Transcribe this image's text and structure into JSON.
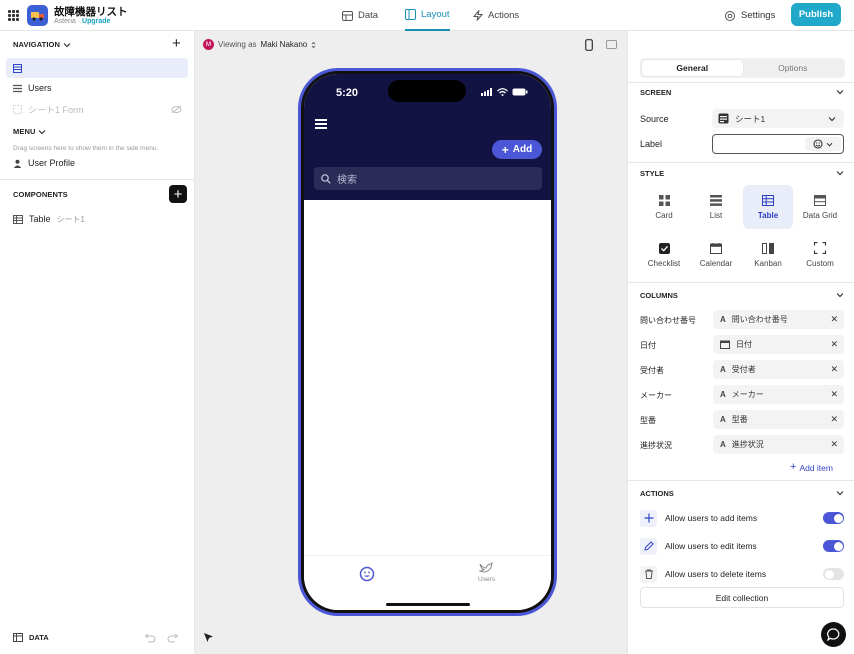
{
  "app": {
    "title": "故障機器リスト",
    "org": "Asteria",
    "separator": " · ",
    "upgrade": "Upgrade"
  },
  "topnav": {
    "tabs": [
      "Data",
      "Layout",
      "Actions"
    ],
    "active_tab": "Layout",
    "settings": "Settings",
    "publish": "Publish"
  },
  "navigation": {
    "header": "NAVIGATION",
    "items": [
      {
        "label": "",
        "selected": true
      },
      {
        "label": "Users"
      },
      {
        "label": "シート1 Form",
        "hidden": true
      }
    ]
  },
  "menu": {
    "header": "MENU",
    "hint": "Drag screens here to show them in the side menu.",
    "items": [
      {
        "label": "User Profile"
      }
    ]
  },
  "components": {
    "header": "COMPONENTS",
    "items": [
      {
        "label": "Table",
        "source": "シート1"
      }
    ]
  },
  "footer": {
    "data_label": "DATA"
  },
  "canvas": {
    "viewing_prefix": "Viewing as",
    "viewing_user": "Maki Nakano",
    "avatar_initial": "M"
  },
  "phone": {
    "time": "5:20",
    "add_button": "Add",
    "search_placeholder": "検索",
    "tabs": [
      {
        "label": "",
        "icon": "smiley-icon"
      },
      {
        "label": "Users",
        "icon": "bird-icon"
      }
    ]
  },
  "panel": {
    "tabs": [
      "General",
      "Options"
    ],
    "active_tab": "General",
    "screen": {
      "header": "SCREEN",
      "source_label": "Source",
      "source_value": "シート1",
      "label_label": "Label",
      "label_value": ""
    },
    "style": {
      "header": "STYLE",
      "options": [
        "Card",
        "List",
        "Table",
        "Data Grid",
        "Checklist",
        "Calendar",
        "Kanban",
        "Custom"
      ],
      "selected": "Table"
    },
    "columns": {
      "header": "COLUMNS",
      "items": [
        {
          "name": "問い合わせ番号",
          "value": "問い合わせ番号",
          "type": "text"
        },
        {
          "name": "日付",
          "value": "日付",
          "type": "date"
        },
        {
          "name": "受付者",
          "value": "受付者",
          "type": "text"
        },
        {
          "name": "メーカー",
          "value": "メーカー",
          "type": "text"
        },
        {
          "name": "型番",
          "value": "型番",
          "type": "text"
        },
        {
          "name": "進捗状況",
          "value": "進捗状況",
          "type": "text"
        }
      ],
      "add_item": "Add item"
    },
    "actions": {
      "header": "ACTIONS",
      "items": [
        {
          "label": "Allow users to add items",
          "enabled": true
        },
        {
          "label": "Allow users to edit items",
          "enabled": true
        },
        {
          "label": "Allow users to delete items",
          "enabled": false
        }
      ],
      "edit_collection": "Edit collection"
    }
  },
  "colors": {
    "accent": "#1fa8c9",
    "primary": "#4b57d6",
    "phone_header": "#121342"
  }
}
